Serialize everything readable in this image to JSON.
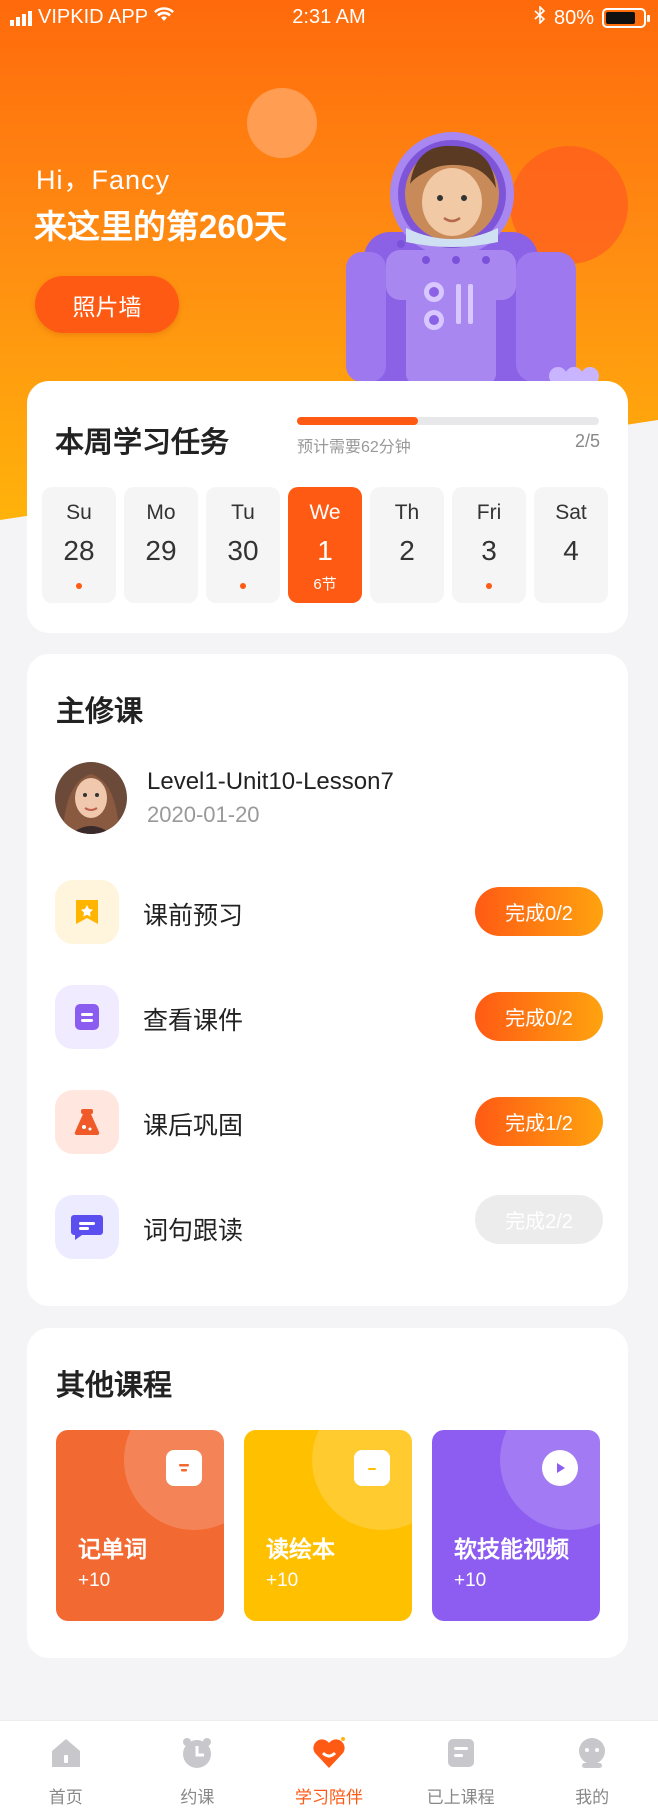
{
  "status_bar": {
    "carrier": "VIPKID APP",
    "time": "2:31 AM",
    "battery": "80%",
    "battery_level": 0.8
  },
  "header": {
    "greeting": "Hi，Fancy",
    "days_text": "来这里的第260天",
    "photo_wall_label": "照片墙"
  },
  "weekly": {
    "title": "本周学习任务",
    "progress": 0.4,
    "eta": "预计需要62分钟",
    "ratio": "2/5",
    "days": [
      {
        "name": "Su",
        "date": "28",
        "dot": true
      },
      {
        "name": "Mo",
        "date": "29",
        "dot": false
      },
      {
        "name": "Tu",
        "date": "30",
        "dot": true
      },
      {
        "name": "We",
        "date": "1",
        "sub": "6节",
        "active": true
      },
      {
        "name": "Th",
        "date": "2",
        "dot": false
      },
      {
        "name": "Fri",
        "date": "3",
        "dot": true
      },
      {
        "name": "Sat",
        "date": "4",
        "dot": false
      }
    ]
  },
  "main_course": {
    "title": "主修课",
    "lesson": "Level1-Unit10-Lesson7",
    "date": "2020-01-20",
    "tasks": [
      {
        "label": "课前预习",
        "status": "完成0/2",
        "done": false,
        "icon": "preview-star-icon"
      },
      {
        "label": "查看课件",
        "status": "完成0/2",
        "done": false,
        "icon": "courseware-icon"
      },
      {
        "label": "课后巩固",
        "status": "完成1/2",
        "done": false,
        "icon": "flask-icon"
      },
      {
        "label": "词句跟读",
        "status": "完成2/2",
        "done": true,
        "icon": "chat-bubble-icon"
      }
    ]
  },
  "other_courses": {
    "title": "其他课程",
    "tiles": [
      {
        "name": "记单词",
        "points": "+10",
        "color": "#f26a32",
        "icon": "word-card-icon"
      },
      {
        "name": "读绘本",
        "points": "+10",
        "color": "#ffc000",
        "icon": "book-cat-icon"
      },
      {
        "name": "软技能视频",
        "points": "+10",
        "color": "#8d5df2",
        "icon": "play-icon"
      }
    ]
  },
  "tabbar": [
    {
      "label": "首页",
      "icon": "home-icon"
    },
    {
      "label": "约课",
      "icon": "clock-icon"
    },
    {
      "label": "学习陪伴",
      "icon": "heart-smile-icon",
      "active": true
    },
    {
      "label": "已上课程",
      "icon": "course-list-icon"
    },
    {
      "label": "我的",
      "icon": "profile-icon"
    }
  ],
  "colors": {
    "accent": "#ff5a14",
    "header_top": "#ff6a0c",
    "header_bottom": "#ffb40a"
  }
}
